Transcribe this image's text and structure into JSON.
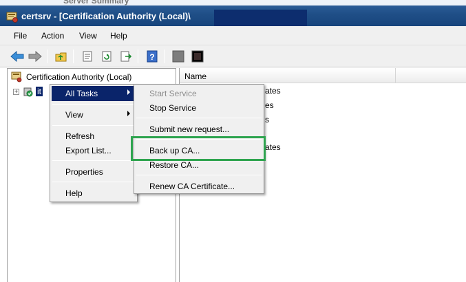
{
  "window": {
    "ghost_text": "Server Summary",
    "title": "certsrv - [Certification Authority (Local)\\",
    "title_bg": "#1f4e86"
  },
  "menubar": {
    "items": [
      "File",
      "Action",
      "View",
      "Help"
    ]
  },
  "toolbar": {
    "buttons": [
      "back-arrow-icon",
      "forward-arrow-icon",
      "up-folder-icon",
      "properties-icon",
      "refresh-icon",
      "export-list-icon",
      "help-icon",
      "stop-service-icon",
      "start-service-icon"
    ]
  },
  "tree": {
    "root_label": "Certification Authority (Local)",
    "node_label": "it",
    "expander": "+"
  },
  "list": {
    "column_name": "Name",
    "items": [
      "ates",
      "es",
      "s",
      "ates"
    ]
  },
  "context_menu": {
    "items": [
      {
        "label": "All Tasks",
        "state": "highlighted",
        "submenu": true
      },
      {
        "label": "View",
        "submenu": true
      },
      {
        "label": "Refresh"
      },
      {
        "label": "Export List..."
      },
      {
        "label": "Properties"
      },
      {
        "label": "Help"
      }
    ]
  },
  "submenu": {
    "items": [
      {
        "label": "Start Service",
        "state": "disabled"
      },
      {
        "label": "Stop Service"
      },
      {
        "label": "Submit new request..."
      },
      {
        "label": "Back up CA..."
      },
      {
        "label": "Restore CA..."
      },
      {
        "label": "Renew CA Certificate..."
      }
    ]
  },
  "annotation": {
    "highlight_color": "#2ea44f",
    "target": "Back up CA..."
  }
}
